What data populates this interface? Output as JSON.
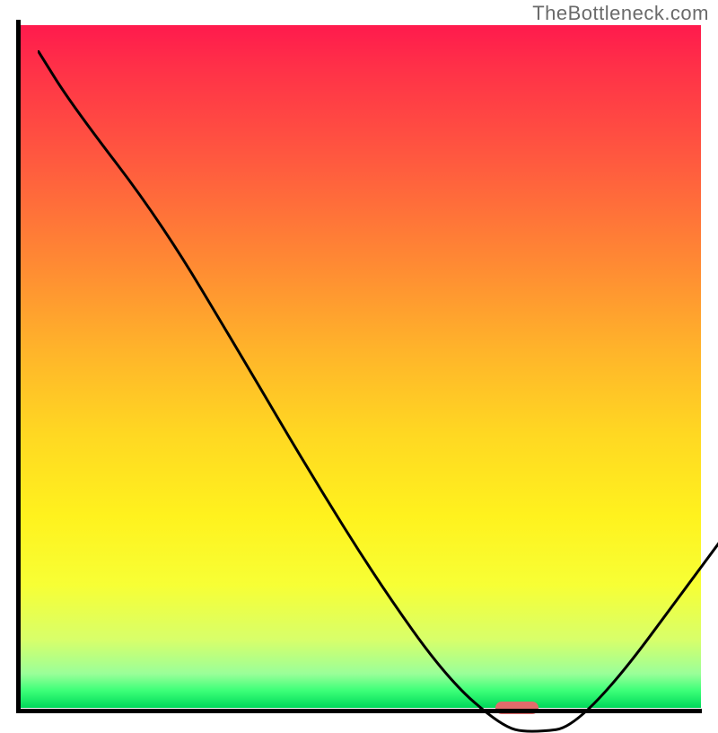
{
  "watermark": "TheBottleneck.com",
  "chart_data": {
    "type": "line",
    "title": "",
    "xlabel": "",
    "ylabel": "",
    "xlim": [
      0,
      100
    ],
    "ylim": [
      0,
      100
    ],
    "grid": false,
    "x": [
      0,
      5,
      18,
      30,
      40,
      50,
      60,
      68,
      72,
      80,
      100
    ],
    "values": [
      100,
      92,
      75,
      55,
      38,
      22,
      8,
      1,
      0,
      1,
      28
    ],
    "marker": {
      "x": 73,
      "y": 0
    },
    "background_gradient": [
      "#ff1a4d",
      "#ffb52a",
      "#fff21e",
      "#00d85a"
    ]
  },
  "colors": {
    "curve": "#000000",
    "marker": "#e26b6b",
    "axis": "#000000",
    "watermark": "#6a6a6a"
  }
}
